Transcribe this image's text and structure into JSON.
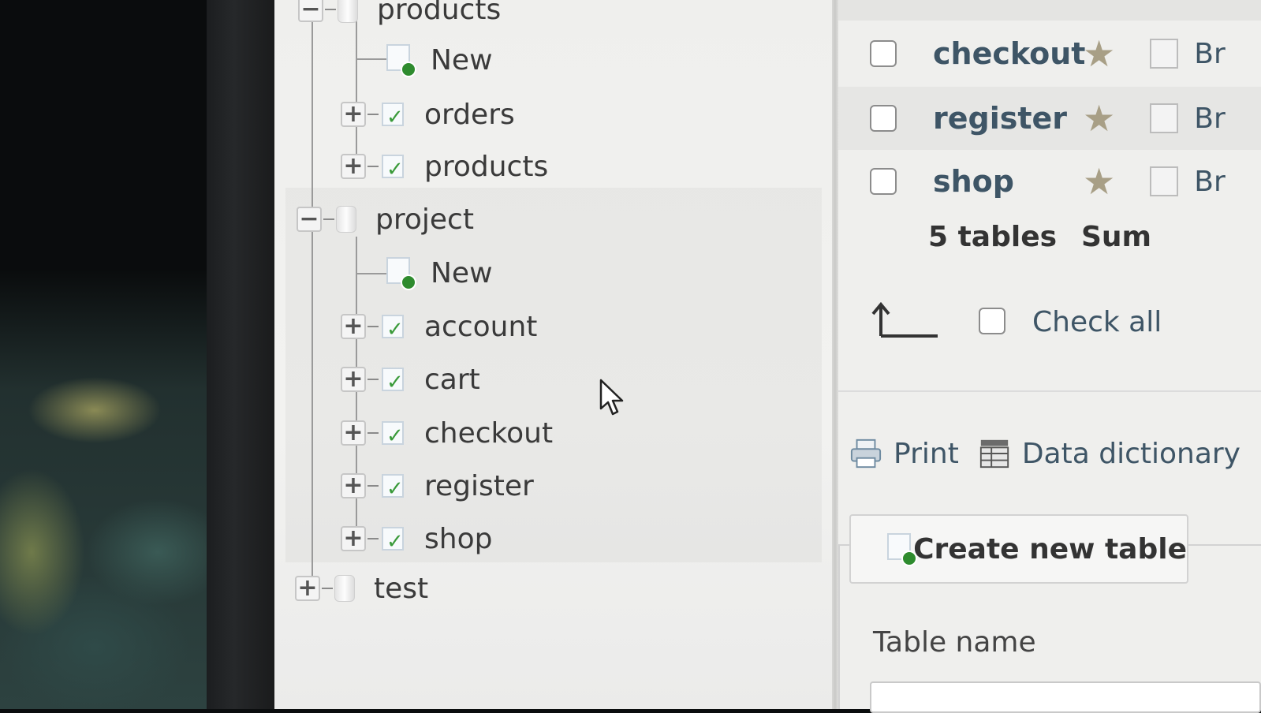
{
  "navigation": {
    "partial_database_label": "products",
    "partial_children": [
      {
        "label": "New",
        "type": "new"
      },
      {
        "label": "orders",
        "type": "table"
      },
      {
        "label": "products",
        "type": "table"
      }
    ],
    "expanded_database": {
      "label": "project",
      "expander": "−",
      "children": [
        {
          "label": "New",
          "type": "new"
        },
        {
          "label": "account",
          "type": "table"
        },
        {
          "label": "cart",
          "type": "table"
        },
        {
          "label": "checkout",
          "type": "table"
        },
        {
          "label": "register",
          "type": "table"
        },
        {
          "label": "shop",
          "type": "table"
        }
      ]
    },
    "collapsed_database": {
      "label": "test",
      "expander": "+"
    }
  },
  "table_list": {
    "rows": [
      {
        "name": "checkout",
        "action": "Br"
      },
      {
        "name": "register",
        "action": "Br"
      },
      {
        "name": "shop",
        "action": "Br"
      }
    ],
    "summary": {
      "tables": "5 tables",
      "label": "Sum"
    },
    "check_all_label": "Check all"
  },
  "tools": {
    "print_label": "Print",
    "data_dictionary_label": "Data dictionary"
  },
  "create_table": {
    "button_label": "Create new table",
    "table_name_label": "Table name"
  },
  "icons": {
    "expand": "plus-icon",
    "collapse": "minus-icon",
    "table": "table-icon",
    "new": "new-table-icon",
    "database": "database-icon",
    "favorite": "star-icon",
    "print": "print-icon",
    "dictionary": "data-dictionary-icon",
    "browse": "browse-icon"
  },
  "colors": {
    "link": "#3e5566",
    "new_badge": "#2e8b2e",
    "star": "#a89f86"
  }
}
